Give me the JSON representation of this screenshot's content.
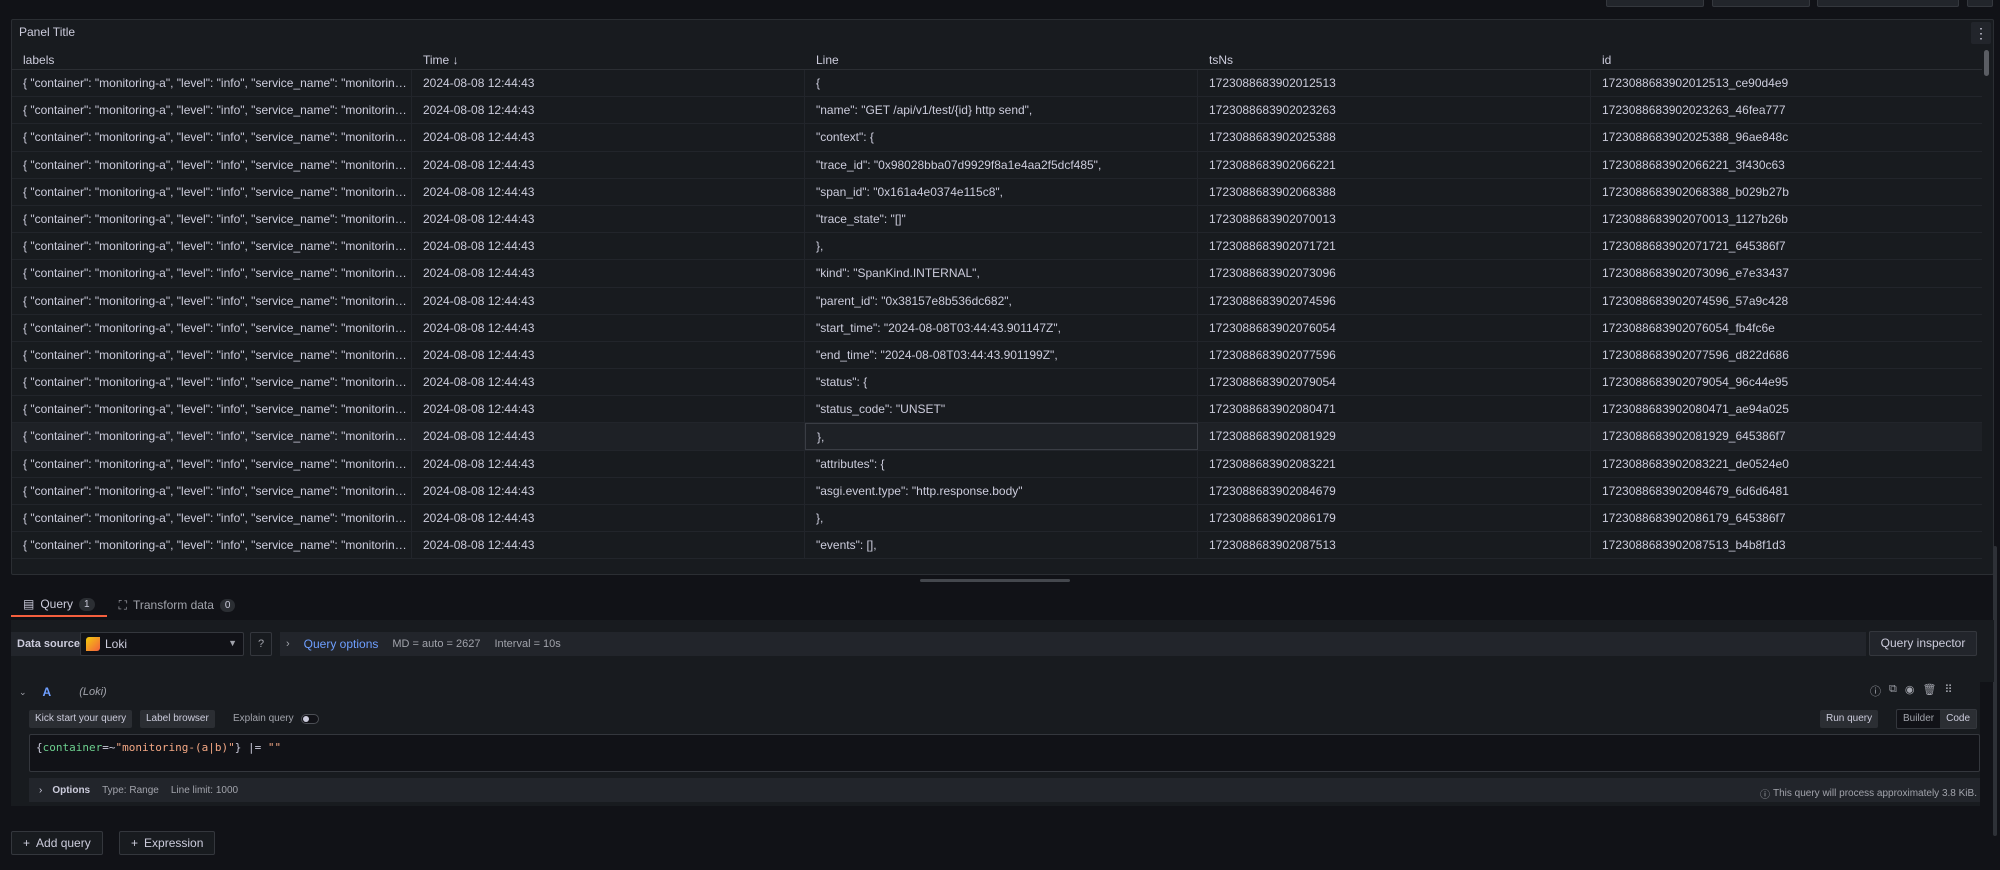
{
  "panel": {
    "title": "Panel Title",
    "columns": [
      "labels",
      "Time",
      "Line",
      "tsNs",
      "id"
    ],
    "sort_icon": "arrow-down-icon",
    "rows": [
      {
        "labels": "{ \"container\": \"monitoring-a\", \"level\": \"info\", \"service_name\": \"monitoring-a\" }",
        "time": "2024-08-08 12:44:43",
        "line": "{",
        "tsNs": "1723088683902012513",
        "id": "1723088683902012513_ce90d4e9"
      },
      {
        "labels": "{ \"container\": \"monitoring-a\", \"level\": \"info\", \"service_name\": \"monitoring-a\" }",
        "time": "2024-08-08 12:44:43",
        "line": "\"name\": \"GET /api/v1/test/{id} http send\",",
        "tsNs": "1723088683902023263",
        "id": "1723088683902023263_46fea777"
      },
      {
        "labels": "{ \"container\": \"monitoring-a\", \"level\": \"info\", \"service_name\": \"monitoring-a\" }",
        "time": "2024-08-08 12:44:43",
        "line": "\"context\": {",
        "tsNs": "1723088683902025388",
        "id": "1723088683902025388_96ae848c"
      },
      {
        "labels": "{ \"container\": \"monitoring-a\", \"level\": \"info\", \"service_name\": \"monitoring-a\" }",
        "time": "2024-08-08 12:44:43",
        "line": "\"trace_id\": \"0x98028bba07d9929f8a1e4aa2f5dcf485\",",
        "tsNs": "1723088683902066221",
        "id": "1723088683902066221_3f430c63"
      },
      {
        "labels": "{ \"container\": \"monitoring-a\", \"level\": \"info\", \"service_name\": \"monitoring-a\" }",
        "time": "2024-08-08 12:44:43",
        "line": "\"span_id\": \"0x161a4e0374e115c8\",",
        "tsNs": "1723088683902068388",
        "id": "1723088683902068388_b029b27b"
      },
      {
        "labels": "{ \"container\": \"monitoring-a\", \"level\": \"info\", \"service_name\": \"monitoring-a\" }",
        "time": "2024-08-08 12:44:43",
        "line": "\"trace_state\": \"[]\"",
        "tsNs": "1723088683902070013",
        "id": "1723088683902070013_1127b26b"
      },
      {
        "labels": "{ \"container\": \"monitoring-a\", \"level\": \"info\", \"service_name\": \"monitoring-a\" }",
        "time": "2024-08-08 12:44:43",
        "line": "},",
        "tsNs": "1723088683902071721",
        "id": "1723088683902071721_645386f7"
      },
      {
        "labels": "{ \"container\": \"monitoring-a\", \"level\": \"info\", \"service_name\": \"monitoring-a\" }",
        "time": "2024-08-08 12:44:43",
        "line": "\"kind\": \"SpanKind.INTERNAL\",",
        "tsNs": "1723088683902073096",
        "id": "1723088683902073096_e7e33437"
      },
      {
        "labels": "{ \"container\": \"monitoring-a\", \"level\": \"info\", \"service_name\": \"monitoring-a\" }",
        "time": "2024-08-08 12:44:43",
        "line": "\"parent_id\": \"0x38157e8b536dc682\",",
        "tsNs": "1723088683902074596",
        "id": "1723088683902074596_57a9c428"
      },
      {
        "labels": "{ \"container\": \"monitoring-a\", \"level\": \"info\", \"service_name\": \"monitoring-a\" }",
        "time": "2024-08-08 12:44:43",
        "line": "\"start_time\": \"2024-08-08T03:44:43.901147Z\",",
        "tsNs": "1723088683902076054",
        "id": "1723088683902076054_fb4fc6e"
      },
      {
        "labels": "{ \"container\": \"monitoring-a\", \"level\": \"info\", \"service_name\": \"monitoring-a\" }",
        "time": "2024-08-08 12:44:43",
        "line": "\"end_time\": \"2024-08-08T03:44:43.901199Z\",",
        "tsNs": "1723088683902077596",
        "id": "1723088683902077596_d822d686"
      },
      {
        "labels": "{ \"container\": \"monitoring-a\", \"level\": \"info\", \"service_name\": \"monitoring-a\" }",
        "time": "2024-08-08 12:44:43",
        "line": "\"status\": {",
        "tsNs": "1723088683902079054",
        "id": "1723088683902079054_96c44e95"
      },
      {
        "labels": "{ \"container\": \"monitoring-a\", \"level\": \"info\", \"service_name\": \"monitoring-a\" }",
        "time": "2024-08-08 12:44:43",
        "line": "\"status_code\": \"UNSET\"",
        "tsNs": "1723088683902080471",
        "id": "1723088683902080471_ae94a025"
      },
      {
        "labels": "{ \"container\": \"monitoring-a\", \"level\": \"info\", \"service_name\": \"monitoring-a\" }",
        "time": "2024-08-08 12:44:43",
        "line": "},",
        "tsNs": "1723088683902081929",
        "id": "1723088683902081929_645386f7"
      },
      {
        "labels": "{ \"container\": \"monitoring-a\", \"level\": \"info\", \"service_name\": \"monitoring-a\" }",
        "time": "2024-08-08 12:44:43",
        "line": "\"attributes\": {",
        "tsNs": "1723088683902083221",
        "id": "1723088683902083221_de0524e0"
      },
      {
        "labels": "{ \"container\": \"monitoring-a\", \"level\": \"info\", \"service_name\": \"monitoring-a\" }",
        "time": "2024-08-08 12:44:43",
        "line": "\"asgi.event.type\": \"http.response.body\"",
        "tsNs": "1723088683902084679",
        "id": "1723088683902084679_6d6d6481"
      },
      {
        "labels": "{ \"container\": \"monitoring-a\", \"level\": \"info\", \"service_name\": \"monitoring-a\" }",
        "time": "2024-08-08 12:44:43",
        "line": "},",
        "tsNs": "1723088683902086179",
        "id": "1723088683902086179_645386f7"
      },
      {
        "labels": "{ \"container\": \"monitoring-a\", \"level\": \"info\", \"service_name\": \"monitoring-a\" }",
        "time": "2024-08-08 12:44:43",
        "line": "\"events\": [],",
        "tsNs": "1723088683902087513",
        "id": "1723088683902087513_b4b8f1d3"
      }
    ]
  },
  "tabs": [
    {
      "label": "Query",
      "count": "1",
      "icon": "database-icon"
    },
    {
      "label": "Transform data",
      "count": "0",
      "icon": "transform-icon"
    }
  ],
  "datasource": {
    "label": "Data source",
    "selected": "Loki",
    "query_options_label": "Query options",
    "md": "MD = auto = 2627",
    "interval": "Interval = 10s",
    "inspector_label": "Query inspector"
  },
  "query": {
    "letter": "A",
    "ds_name": "(Loki)",
    "kick_start_label": "Kick start your query",
    "label_browser_label": "Label browser",
    "explain_label": "Explain query",
    "run_label": "Run query",
    "builder_label": "Builder",
    "code_label": "Code",
    "code": {
      "open": "{",
      "label": "container",
      "op": "=~",
      "value": "\"monitoring-(a|b)\"",
      "close": "}",
      "pipe": " |= ",
      "filter": "\"\""
    },
    "options_label": "Options",
    "type": "Type: Range",
    "line_limit": "Line limit: 1000",
    "hint": "This query will process approximately 3.8 KiB."
  },
  "footer": {
    "add_query": "Add query",
    "expression": "Expression"
  },
  "colors": {
    "accent": "#6e9fff",
    "tab_active": "#f55f3e",
    "background": "#111217"
  }
}
